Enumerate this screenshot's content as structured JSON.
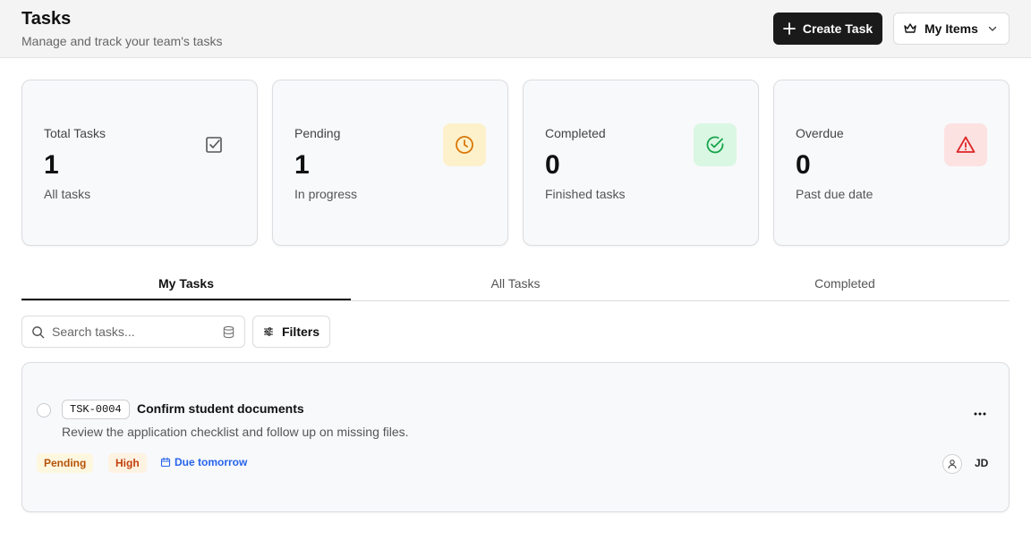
{
  "header": {
    "title": "Tasks",
    "subtitle": "Manage and track your team's tasks",
    "create_label": "Create Task",
    "myitems_label": "My Items"
  },
  "stats": [
    {
      "label": "Total Tasks",
      "value": "1",
      "sub": "All tasks",
      "icon": "check-square-icon",
      "color": "#555555",
      "bg": "transparent"
    },
    {
      "label": "Pending",
      "value": "1",
      "sub": "In progress",
      "icon": "clock-icon",
      "color": "#d97706",
      "bg": "#fdf1cc"
    },
    {
      "label": "Completed",
      "value": "0",
      "sub": "Finished tasks",
      "icon": "check-circle-icon",
      "color": "#16a34a",
      "bg": "#daf7e3"
    },
    {
      "label": "Overdue",
      "value": "0",
      "sub": "Past due date",
      "icon": "alert-triangle-icon",
      "color": "#dc2626",
      "bg": "#fde2e2"
    }
  ],
  "tabs": [
    {
      "label": "My Tasks",
      "active": true
    },
    {
      "label": "All Tasks",
      "active": false
    },
    {
      "label": "Completed",
      "active": false
    }
  ],
  "search": {
    "placeholder": "Search tasks...",
    "value": ""
  },
  "filters_label": "Filters",
  "tasks": [
    {
      "id": "TSK-0004",
      "title": "Confirm student documents",
      "description": "Review the application checklist and follow up on missing files.",
      "status": "Pending",
      "priority": "High",
      "due": "Due tomorrow",
      "assignee": "JD"
    }
  ],
  "colors": {
    "primary": "#1a1a1a",
    "pending": "#b45309",
    "high": "#c2410c",
    "due": "#2563eb"
  }
}
